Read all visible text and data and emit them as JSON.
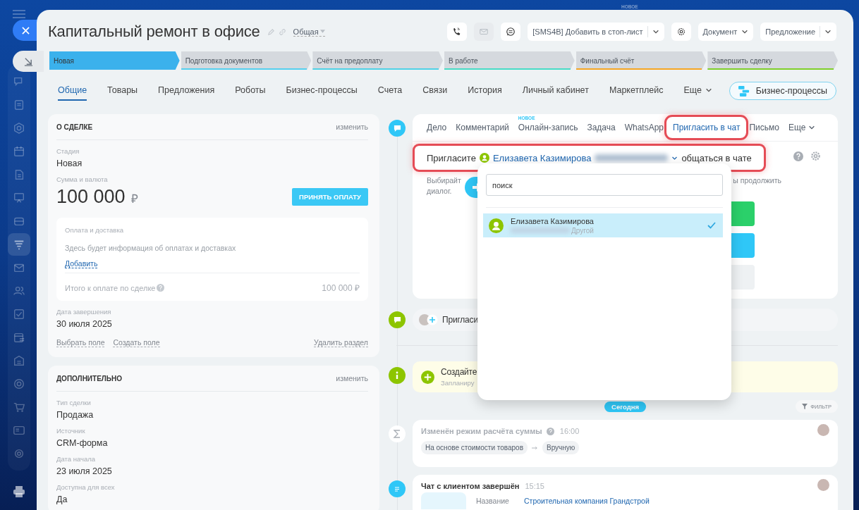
{
  "top_badge": "НОВОЕ",
  "sidebar": {
    "items": [
      {
        "selected": false
      },
      {
        "selected": false
      },
      {
        "selected": false
      },
      {
        "selected": false
      },
      {
        "selected": false
      },
      {
        "selected": false
      },
      {
        "selected": false
      },
      {
        "selected": true
      },
      {
        "selected": false
      },
      {
        "selected": false
      },
      {
        "selected": false
      },
      {
        "selected": false
      },
      {
        "selected": false
      },
      {
        "selected": false
      },
      {
        "selected": false
      },
      {
        "selected": false
      },
      {
        "selected": false
      }
    ]
  },
  "header": {
    "title": "Капитальный ремонт в офисе",
    "category": "Общая",
    "actions": [
      {
        "kind": "phone",
        "disabled": false
      },
      {
        "kind": "mail",
        "disabled": true
      },
      {
        "kind": "chat",
        "disabled": false
      },
      {
        "kind": "split",
        "label": "[SMS4B] Добавить в стоп-лист",
        "disabled": false
      },
      {
        "kind": "settings",
        "disabled": false
      },
      {
        "kind": "dropdown",
        "label": "Документ",
        "disabled": false
      },
      {
        "kind": "split",
        "label": "Предложение",
        "disabled": false
      }
    ]
  },
  "stages": [
    {
      "label": "Новая",
      "selected": true,
      "color": "#3bb1ec"
    },
    {
      "label": "Подготовка документов",
      "selected": false,
      "color": "#55d0ef"
    },
    {
      "label": "Счёт на предоплату",
      "selected": false,
      "color": "#4fd2e6"
    },
    {
      "label": "В работе",
      "selected": false,
      "color": "#47dcc6"
    },
    {
      "label": "Финальный счёт",
      "selected": false,
      "color": "#f5a623"
    },
    {
      "label": "Завершить сделку",
      "selected": false,
      "color": "#7fcf2a"
    }
  ],
  "tabs": [
    {
      "label": "Общие",
      "selected": true,
      "kind": "tab"
    },
    {
      "label": "Товары",
      "selected": false,
      "kind": "tab"
    },
    {
      "label": "Предложения",
      "selected": false,
      "kind": "tab"
    },
    {
      "label": "Роботы",
      "selected": false,
      "kind": "tab"
    },
    {
      "label": "Бизнес-процессы",
      "selected": false,
      "kind": "tab"
    },
    {
      "label": "Счета",
      "selected": false,
      "kind": "tab"
    },
    {
      "label": "Связи",
      "selected": false,
      "kind": "tab"
    },
    {
      "label": "История",
      "selected": false,
      "kind": "tab"
    },
    {
      "label": "Личный кабинет",
      "selected": false,
      "kind": "tab"
    },
    {
      "label": "Маркетплейс",
      "selected": false,
      "kind": "tab"
    },
    {
      "label": "Еще",
      "selected": false,
      "kind": "more"
    }
  ],
  "process_button": "Бизнес-процессы",
  "deal_card": {
    "title": "О СДЕЛКЕ",
    "edit": "изменить",
    "stage_label": "Стадия",
    "stage": "Новая",
    "amount_label": "Сумма и валюта",
    "amount": "100 000",
    "currency": "₽",
    "pay_button": "ПРИНЯТЬ ОПЛАТУ",
    "payment": {
      "title": "Оплата и доставка",
      "text": "Здесь будет информация об оплатах и доставках",
      "add": "Добавить",
      "total_label": "Итого к оплате по сделке",
      "total": "100 000 ₽"
    },
    "fields": [
      {
        "label": "Дата завершения",
        "value": "30 июля 2025"
      }
    ],
    "links": [
      "Выбрать поле",
      "Создать поле"
    ],
    "delete": "Удалить раздел"
  },
  "extra_card": {
    "title": "ДОПОЛНИТЕЛЬНО",
    "edit": "изменить",
    "fields": [
      {
        "label": "Тип сделки",
        "value": "Продажа"
      },
      {
        "label": "Источник",
        "value": "CRM-форма"
      },
      {
        "label": "Дата начала",
        "value": "23 июля 2025"
      },
      {
        "label": "Доступна для всех",
        "value": "Да"
      }
    ]
  },
  "composer": {
    "tabs": [
      {
        "label": "Дело",
        "selected": false,
        "framed": false
      },
      {
        "label": "Комментарий",
        "selected": false,
        "framed": false
      },
      {
        "label": "Онлайн-запись",
        "selected": false,
        "framed": false,
        "badge": "НОВОЕ"
      },
      {
        "label": "Задача",
        "selected": false,
        "framed": false
      },
      {
        "label": "WhatsApp",
        "selected": false,
        "framed": false
      },
      {
        "label": "Пригласить в чат",
        "selected": true,
        "framed": true
      },
      {
        "label": "Письмо",
        "selected": false,
        "framed": false
      },
      {
        "label": "Еще",
        "selected": false,
        "framed": false,
        "more": true
      }
    ],
    "invite": {
      "prefix": "Пригласите",
      "contact": "Елизавета Казимирова",
      "suffix": "общаться в чате",
      "framed": true
    },
    "hint_lines": [
      "Выбирайт",
      "диалог."
    ],
    "hint_end": "ы продолжить"
  },
  "popup": {
    "search_placeholder": "поиск",
    "contacts": [
      {
        "name": "Елизавета Казимирова",
        "type": "Другой",
        "selected": true
      }
    ]
  },
  "timeline": {
    "invite_text": "Пригласи",
    "info_title": "Создайте",
    "info_text": "Запланиру",
    "today": "Сегодня",
    "filter": "ФИЛЬТР",
    "items": [
      {
        "kind": "change",
        "title": "Изменён режим расчёта суммы",
        "time": "16:00",
        "from": "На основе стоимости товаров",
        "to": "Вручную"
      },
      {
        "kind": "chat",
        "title": "Чат с клиентом завершён",
        "time": "15:15",
        "field_label": "Название",
        "field_value": "Строительная компания Грандстрой"
      }
    ]
  }
}
